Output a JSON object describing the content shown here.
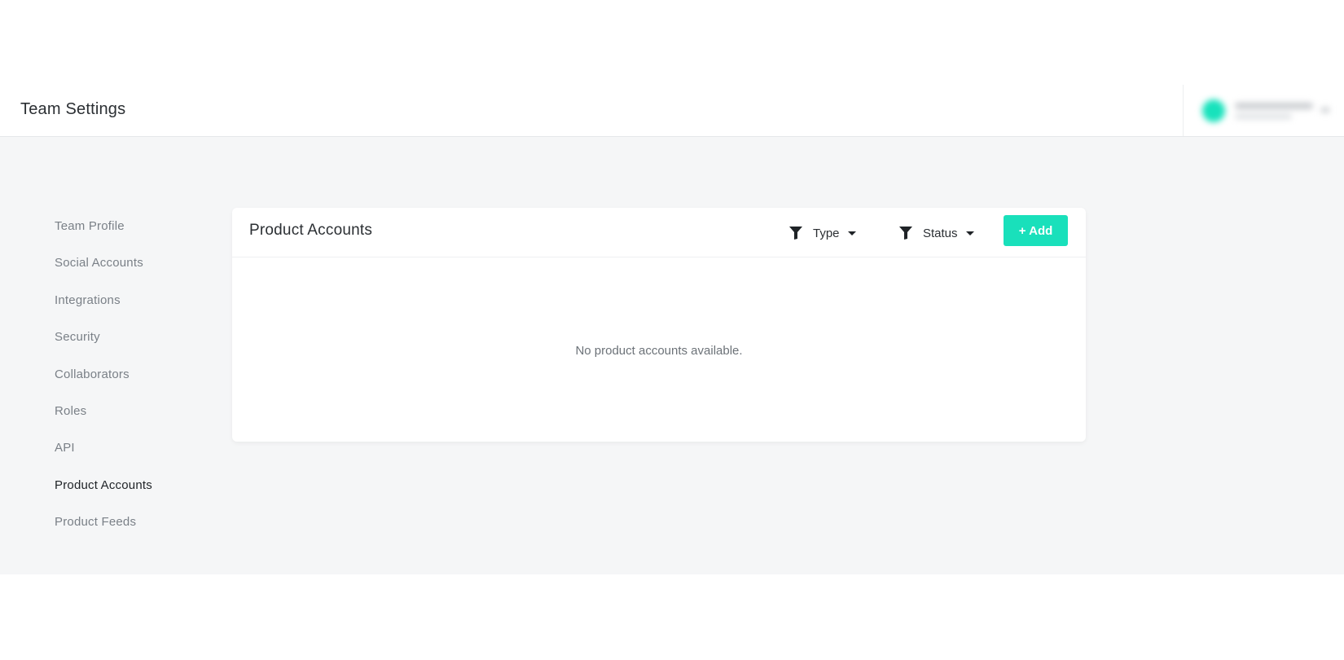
{
  "header": {
    "title": "Team Settings"
  },
  "sidebar": {
    "items": [
      {
        "label": "Team Profile",
        "active": false
      },
      {
        "label": "Social Accounts",
        "active": false
      },
      {
        "label": "Integrations",
        "active": false
      },
      {
        "label": "Security",
        "active": false
      },
      {
        "label": "Collaborators",
        "active": false
      },
      {
        "label": "Roles",
        "active": false
      },
      {
        "label": "API",
        "active": false
      },
      {
        "label": "Product Accounts",
        "active": true
      },
      {
        "label": "Product Feeds",
        "active": false
      }
    ]
  },
  "panel": {
    "title": "Product Accounts",
    "filters": {
      "type_label": "Type",
      "status_label": "Status"
    },
    "add_label": "+ Add",
    "empty_message": "No product accounts available."
  },
  "icons": {
    "filter": "funnel-icon",
    "caret": "caret-down-icon",
    "avatar": "user-avatar"
  },
  "colors": {
    "accent": "#19e0bb",
    "background": "#f5f6f7",
    "text_primary": "#2b2f33",
    "text_muted": "#7a8087"
  }
}
